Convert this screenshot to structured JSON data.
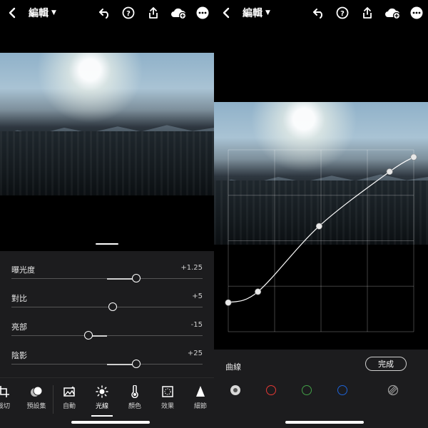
{
  "left": {
    "header": {
      "mode_label": "編輯"
    },
    "sliders": [
      {
        "label": "曝光度",
        "value": "+1.25",
        "level": 0.63
      },
      {
        "label": "對比",
        "value": "+5",
        "level": 0.53
      },
      {
        "label": "亮部",
        "value": "-15",
        "level": 0.43
      },
      {
        "label": "陰影",
        "value": "+25",
        "level": 0.63
      }
    ],
    "tabs": [
      {
        "label": "裁切",
        "icon": "crop-icon"
      },
      {
        "label": "預設集",
        "icon": "presets-icon"
      },
      {
        "label": "自動",
        "icon": "auto-icon"
      },
      {
        "label": "光線",
        "icon": "light-icon",
        "active": true
      },
      {
        "label": "顏色",
        "icon": "thermometer-icon"
      },
      {
        "label": "效果",
        "icon": "effects-icon"
      },
      {
        "label": "細節",
        "icon": "detail-icon"
      }
    ]
  },
  "right": {
    "header": {
      "mode_label": "編輯"
    },
    "curve_label": "曲線",
    "done_label": "完成",
    "channels": [
      "rgb-channel",
      "red-channel",
      "green-channel",
      "blue-channel",
      "split-toning"
    ],
    "curve_points": [
      [
        0.0,
        0.16
      ],
      [
        0.16,
        0.22
      ],
      [
        0.49,
        0.58
      ],
      [
        0.87,
        0.88
      ],
      [
        1.0,
        0.96
      ]
    ]
  },
  "colors": {
    "accent": "#ffffff",
    "panel": "#1c1c1e",
    "red": "#e53935",
    "green": "#43a047",
    "blue": "#1e63d6"
  }
}
